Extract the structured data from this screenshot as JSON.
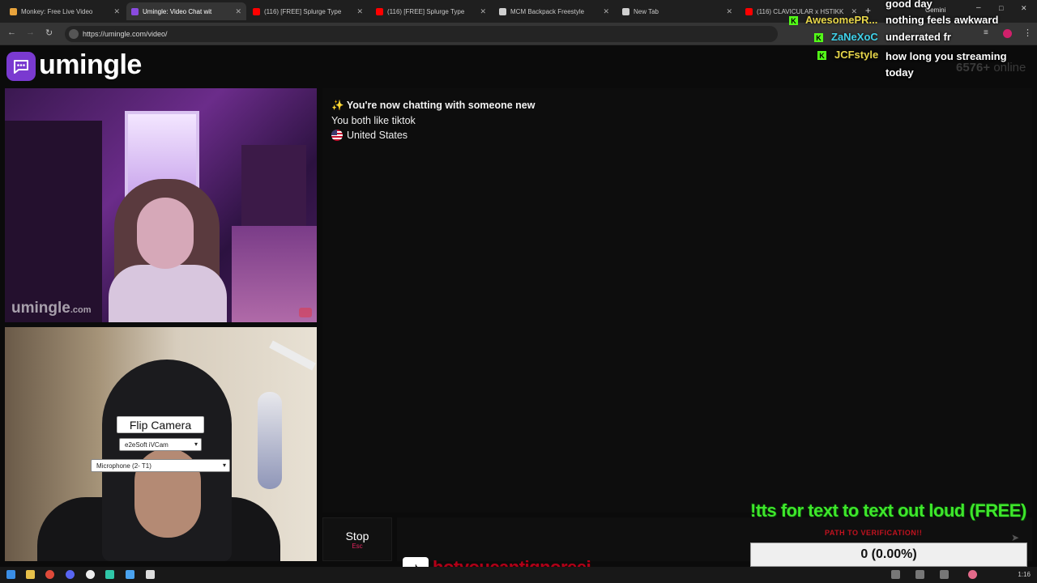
{
  "browser": {
    "tabs": [
      {
        "title": "Monkey: Free Live Video",
        "color": "#e8a33c",
        "active": false
      },
      {
        "title": "Umingle: Video Chat wit",
        "color": "#8a4be0",
        "active": true
      },
      {
        "title": "(116) [FREE] Splurge Type",
        "color": "#ff0000",
        "active": false
      },
      {
        "title": "(116) [FREE] Splurge Type",
        "color": "#ff0000",
        "active": false
      },
      {
        "title": "MCM Backpack Freestyle",
        "color": "#cfcfcf",
        "active": false
      },
      {
        "title": "New Tab",
        "color": "#cfcfcf",
        "active": false
      },
      {
        "title": "(116) CLAVICULAR x HSTIKK",
        "color": "#ff0000",
        "active": false
      }
    ],
    "url": "https://umingle.com/video/",
    "gemini_label": "Gemini"
  },
  "app": {
    "logo_text": "umingle",
    "online_count": "6576+",
    "online_label": "online"
  },
  "partner_video": {
    "watermark": "umingle",
    "watermark_suffix": ".com"
  },
  "self_video": {
    "flip_label": "Flip Camera",
    "camera_select": "e2eSoft iVCam",
    "mic_select": "Microphone (2- T1)"
  },
  "chat": {
    "system_new": "You're now chatting with someone new",
    "shared_interest": "You both like tiktok",
    "country": "United States"
  },
  "controls": {
    "stop_label": "Stop",
    "stop_key": "Esc"
  },
  "overlay": {
    "messages": [
      {
        "user": "",
        "text": "good day",
        "color": "#ffffff"
      },
      {
        "user": "AwesomePR...",
        "text": "nothing feels awkward",
        "color": "#e7d64a"
      },
      {
        "user": "ZaNeXoC",
        "text": "underrated fr",
        "color": "#3fd0e8"
      },
      {
        "user": "JCFstyle",
        "text": "how long you streaming today",
        "color": "#e7d64a"
      }
    ],
    "tts_text": "!tts for text to text out loud (FREE)",
    "verify_text": "PATH TO VERIFICATION!!",
    "goal_value": "0 (0.00%)",
    "tiktok_handle": "hotyoucantignoreej"
  },
  "taskbar": {
    "time": "1:16"
  }
}
